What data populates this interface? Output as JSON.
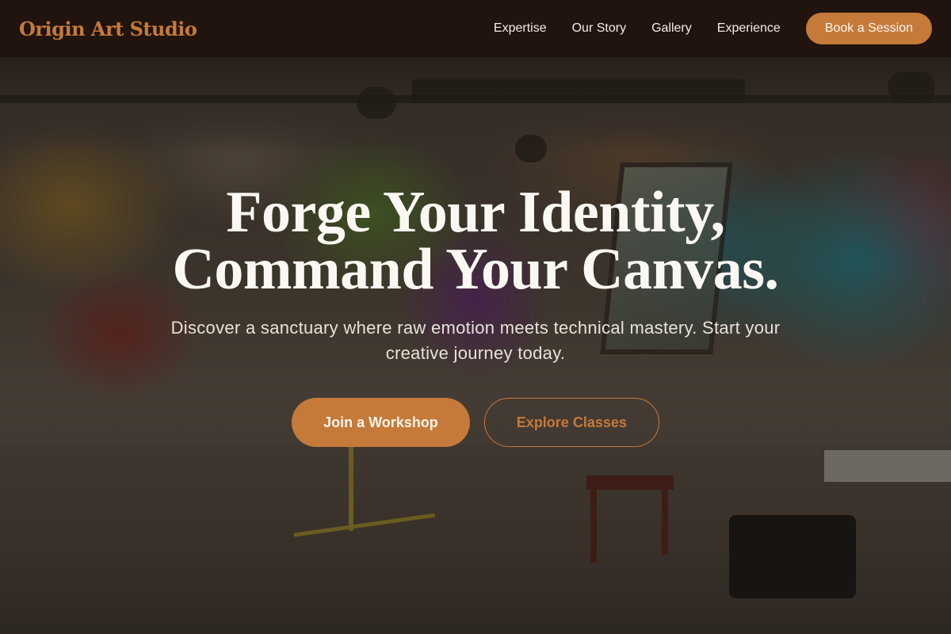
{
  "nav": {
    "brand": "Origin Art Studio",
    "links": [
      "Expertise",
      "Our Story",
      "Gallery",
      "Experience"
    ],
    "cta": "Book a Session"
  },
  "hero": {
    "title_line1": "Forge Your Identity,",
    "title_line2": "Command Your Canvas.",
    "subtitle": "Discover a sanctuary where raw emotion meets technical mastery. Start your creative journey today.",
    "primary_button": "Join a Workshop",
    "secondary_button": "Explore Classes"
  },
  "colors": {
    "accent": "#c57a3a",
    "nav_background": "#21140e",
    "text_light": "#fbf8f3"
  }
}
